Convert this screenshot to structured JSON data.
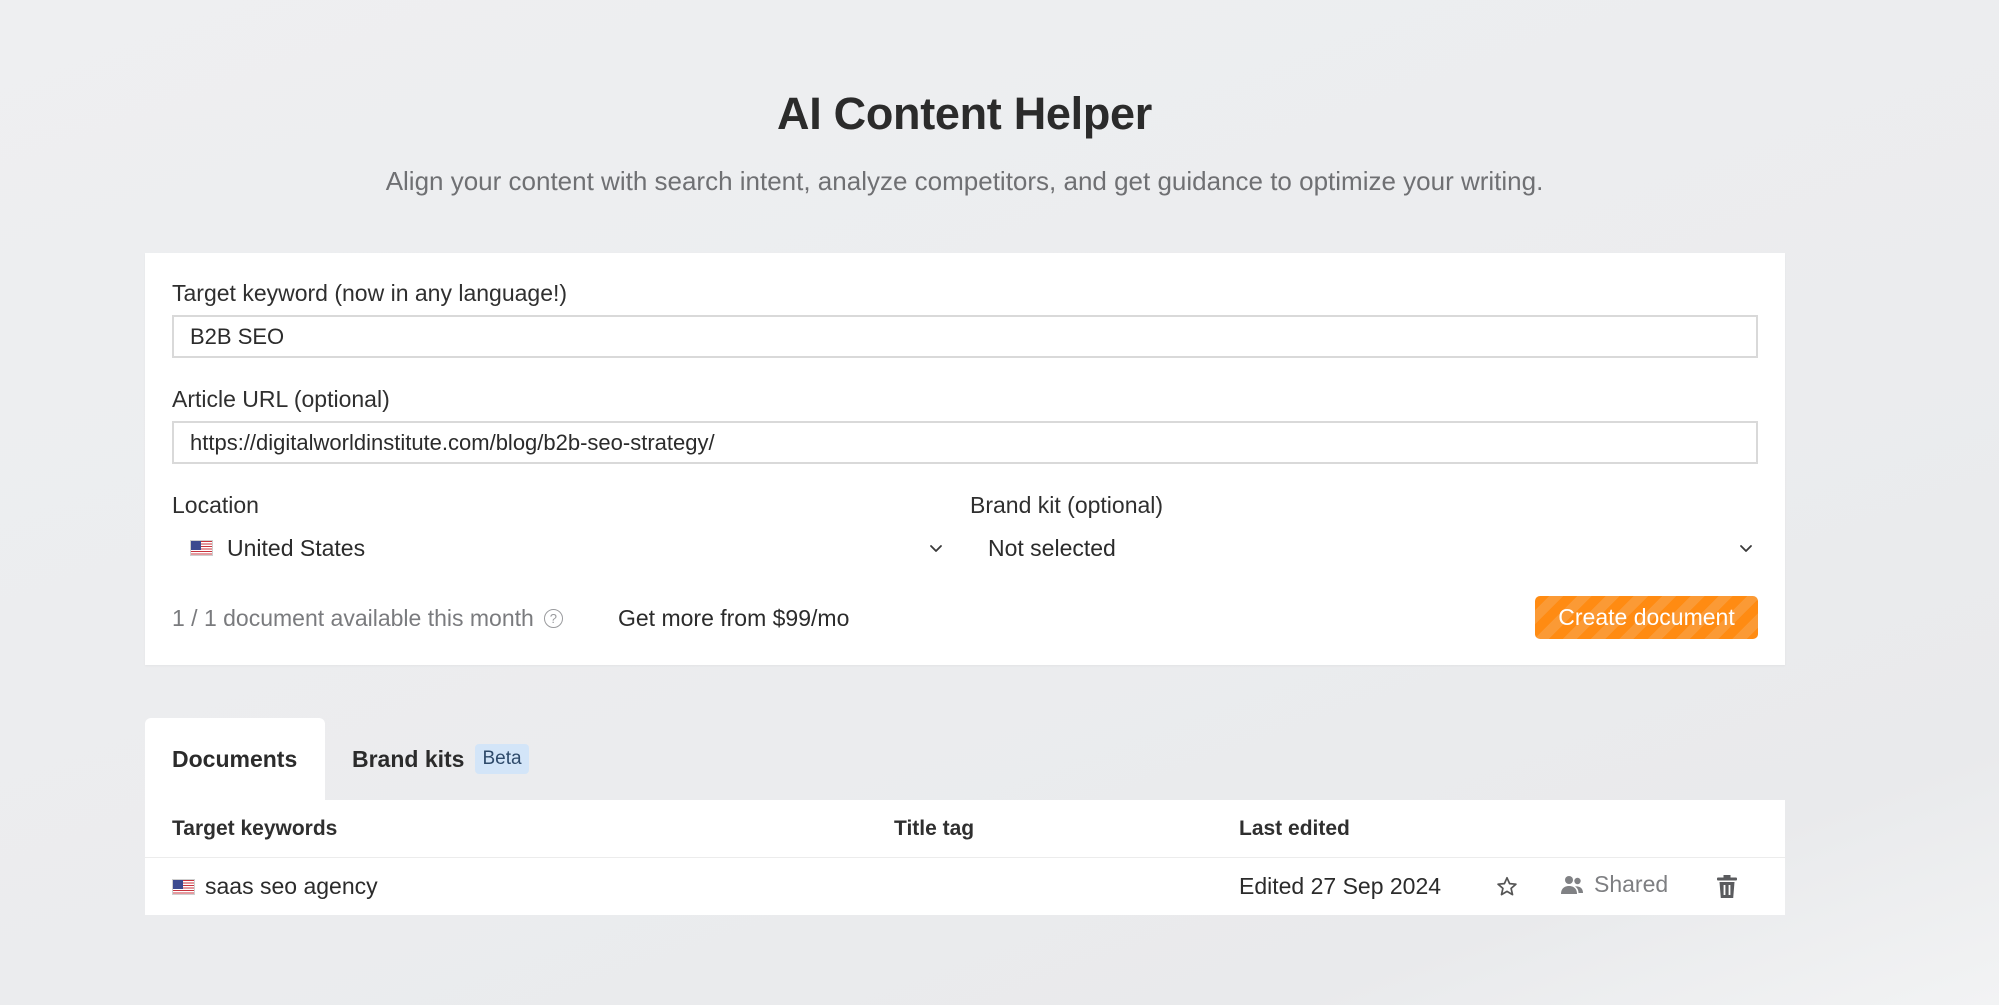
{
  "header": {
    "title": "AI Content Helper",
    "subtitle": "Align your content with search intent, analyze competitors, and get guidance to optimize your writing."
  },
  "form": {
    "keyword_label": "Target keyword (now in any language!)",
    "keyword_value": "B2B SEO",
    "url_label": "Article URL (optional)",
    "url_value": "https://digitalworldinstitute.com/blog/b2b-seo-strategy/",
    "location_label": "Location",
    "location_value": "United States",
    "location_flag": "us-flag-icon",
    "brand_kit_label": "Brand kit (optional)",
    "brand_kit_value": "Not selected",
    "quota_text": "1 / 1 document available this month",
    "help_icon": "question-circle-icon",
    "upgrade_link": "Get more from $99/mo",
    "create_button": "Create document",
    "accent_color": "#ff8b12"
  },
  "tabs": [
    {
      "label": "Documents",
      "active": true
    },
    {
      "label": "Brand kits",
      "badge": "Beta",
      "active": false
    }
  ],
  "table": {
    "columns": [
      "Target keywords",
      "Title tag",
      "Last edited"
    ],
    "rows": [
      {
        "flag": "us-flag-icon",
        "keyword": "saas seo agency",
        "title_tag": "",
        "last_edited": "Edited 27 Sep 2024",
        "star_icon": "star-icon",
        "shared_icon": "users-icon",
        "shared_label": "Shared",
        "delete_icon": "trash-icon"
      }
    ]
  }
}
